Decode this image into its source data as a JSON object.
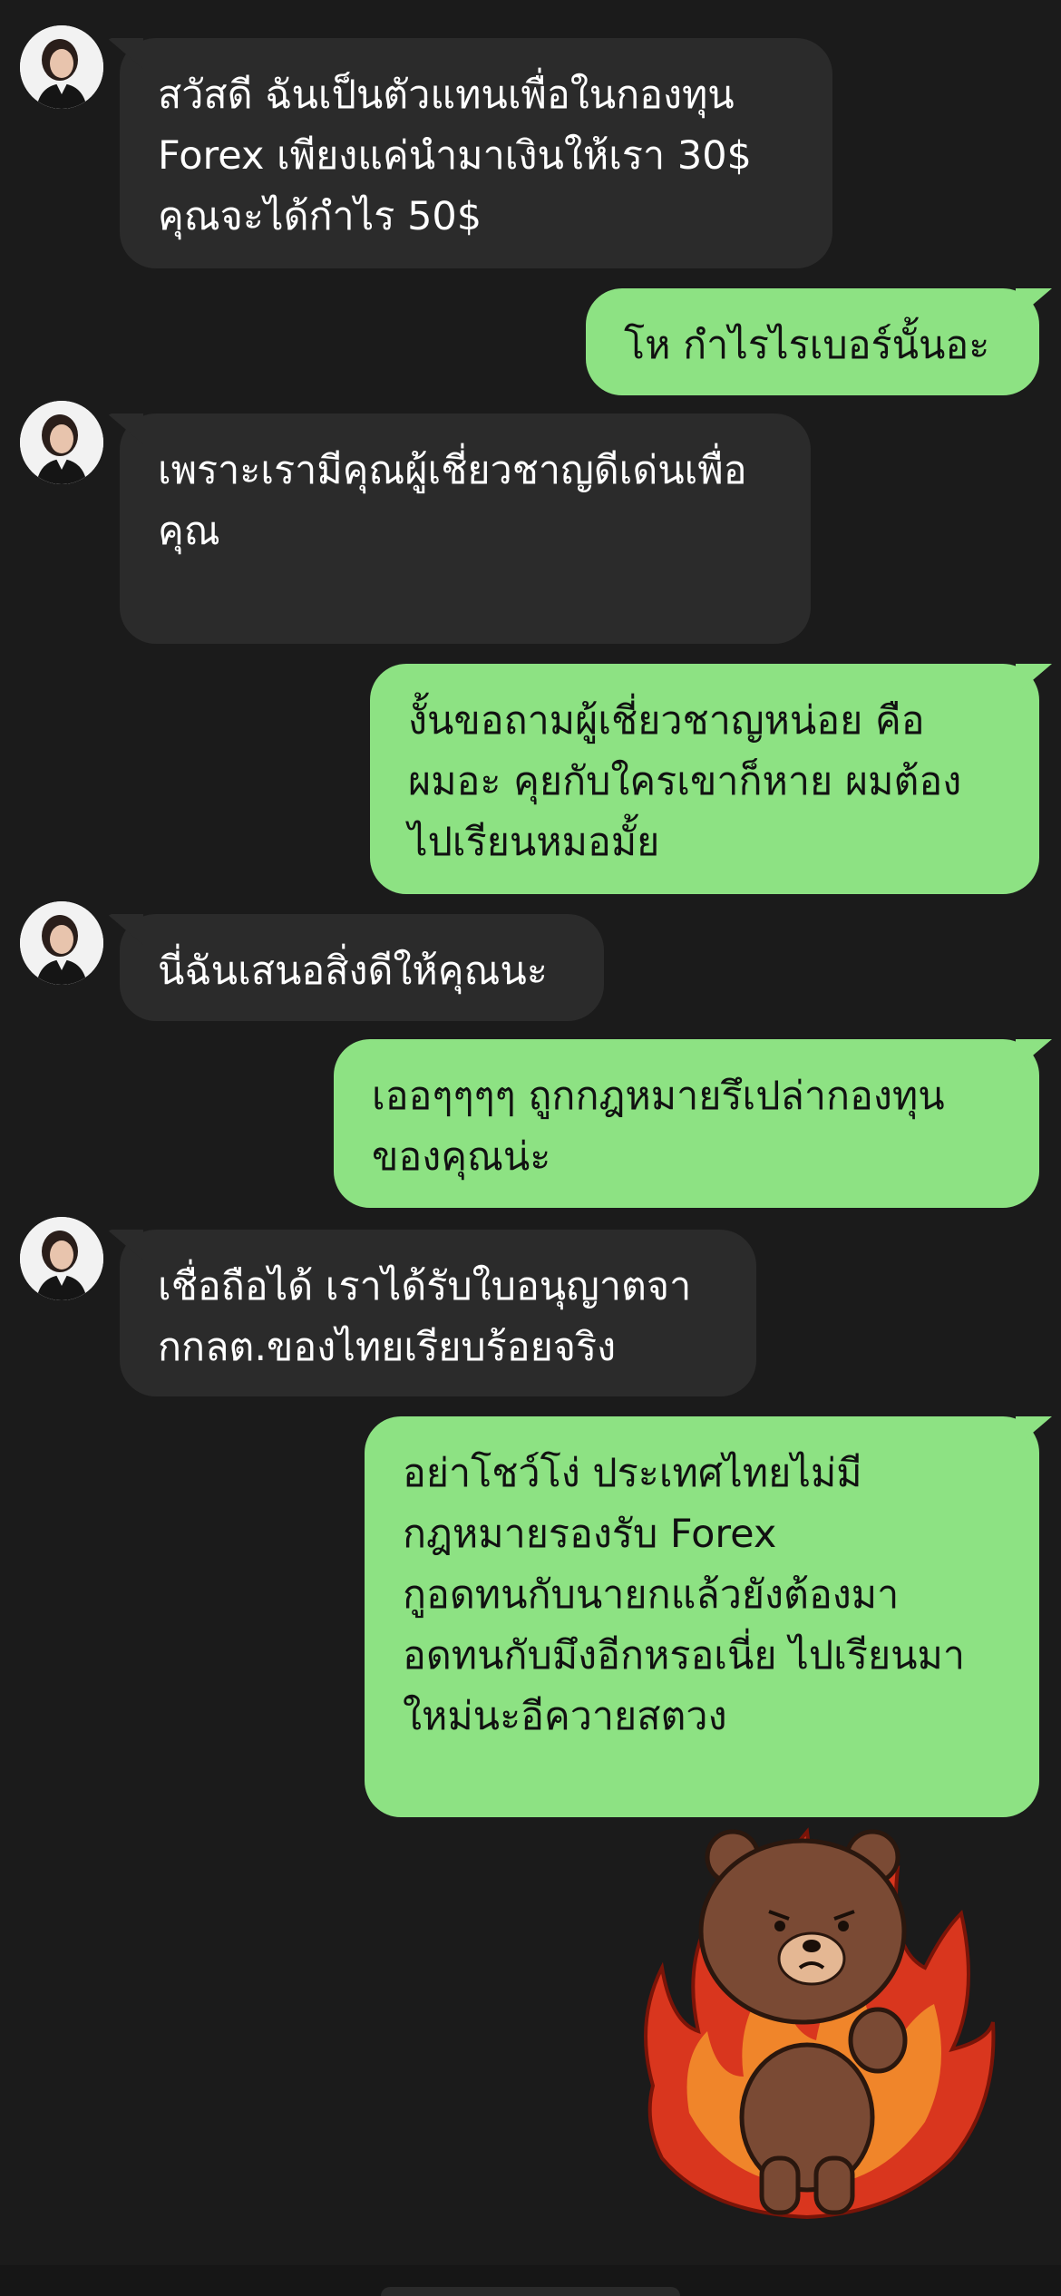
{
  "messages": [
    {
      "side": "in",
      "text": "สวัสดี ฉันเป็นตัวแทนเพื่อในกองทุน\nForex เพียงแค่นำมาเงินให้เรา 30$\nคุณจะได้กำไร 50$"
    },
    {
      "side": "out",
      "text": "โห กำไรไรเบอร์นั้นอะ"
    },
    {
      "side": "in",
      "text": "เพราะเรามีคุณผู้เชี่ยวชาญดีเด่นเพื่อ\nคุณ"
    },
    {
      "side": "out",
      "text": "งั้นขอถามผู้เชี่ยวชาญหน่อย คือ\nผมอะ คุยกับใครเขาก็หาย ผมต้อง\nไปเรียนหมอมั้ย"
    },
    {
      "side": "in",
      "text": "นี่ฉันเสนอสิ่งดีให้คุณนะ"
    },
    {
      "side": "out",
      "text": "เออๆๆๆๆ ถูกกฎหมายรึเปล่ากองทุน\nของคุณน่ะ"
    },
    {
      "side": "in",
      "text": "เชื่อถือได้ เราได้รับใบอนุญาตจา\nกกลต.ของไทยเรียบร้อยจริง"
    },
    {
      "side": "out",
      "text": "อย่าโชว์โง่ ประเทศไทยไม่มี\nกฎหมายรองรับ Forex\nกูอดทนกับนายกแล้วยังต้องมา\nอดทนกับมึงอีกหรอเนี่ย ไปเรียนมา\nใหม่นะอีควายสตวง"
    }
  ],
  "sticker": {
    "icon": "angry-bear-fire-sticker"
  },
  "colors": {
    "background": "#1b1b1b",
    "incoming": "#2b2b2b",
    "outgoing": "#8de283"
  }
}
